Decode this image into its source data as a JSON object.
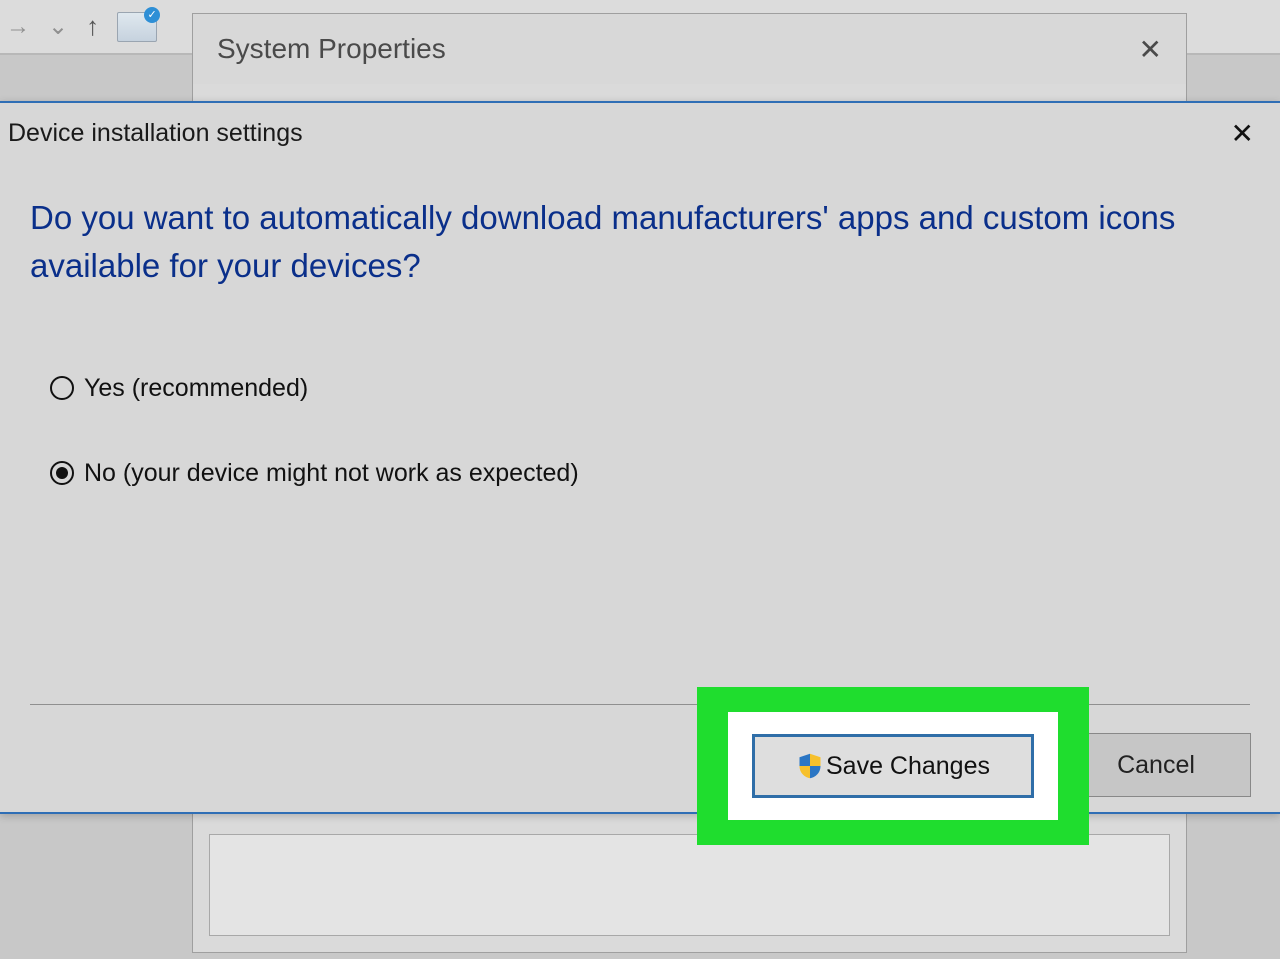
{
  "toolbar": {
    "forward_icon": "→",
    "dropdown_icon": "⌄",
    "up_icon": "↑"
  },
  "sysprop": {
    "title": "System Properties",
    "close": "✕"
  },
  "dialog": {
    "title": "Device installation settings",
    "close": "✕",
    "question": "Do you want to automatically download manufacturers' apps and custom icons available for your devices?",
    "options": {
      "yes": "Yes (recommended)",
      "no": "No (your device might not work as expected)",
      "selected": "no"
    },
    "buttons": {
      "save": "Save Changes",
      "cancel": "Cancel"
    }
  }
}
